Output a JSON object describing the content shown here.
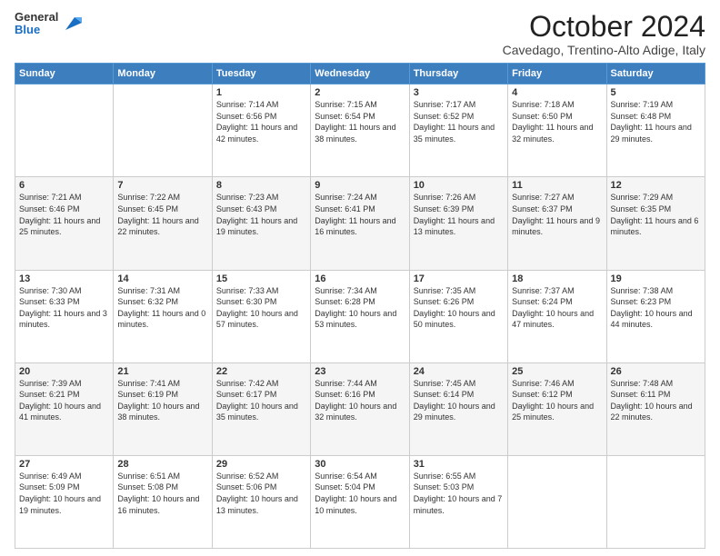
{
  "header": {
    "logo_general": "General",
    "logo_blue": "Blue",
    "month_title": "October 2024",
    "location": "Cavedago, Trentino-Alto Adige, Italy"
  },
  "days_of_week": [
    "Sunday",
    "Monday",
    "Tuesday",
    "Wednesday",
    "Thursday",
    "Friday",
    "Saturday"
  ],
  "weeks": [
    [
      {
        "day": "",
        "info": ""
      },
      {
        "day": "",
        "info": ""
      },
      {
        "day": "1",
        "info": "Sunrise: 7:14 AM\nSunset: 6:56 PM\nDaylight: 11 hours and 42 minutes."
      },
      {
        "day": "2",
        "info": "Sunrise: 7:15 AM\nSunset: 6:54 PM\nDaylight: 11 hours and 38 minutes."
      },
      {
        "day": "3",
        "info": "Sunrise: 7:17 AM\nSunset: 6:52 PM\nDaylight: 11 hours and 35 minutes."
      },
      {
        "day": "4",
        "info": "Sunrise: 7:18 AM\nSunset: 6:50 PM\nDaylight: 11 hours and 32 minutes."
      },
      {
        "day": "5",
        "info": "Sunrise: 7:19 AM\nSunset: 6:48 PM\nDaylight: 11 hours and 29 minutes."
      }
    ],
    [
      {
        "day": "6",
        "info": "Sunrise: 7:21 AM\nSunset: 6:46 PM\nDaylight: 11 hours and 25 minutes."
      },
      {
        "day": "7",
        "info": "Sunrise: 7:22 AM\nSunset: 6:45 PM\nDaylight: 11 hours and 22 minutes."
      },
      {
        "day": "8",
        "info": "Sunrise: 7:23 AM\nSunset: 6:43 PM\nDaylight: 11 hours and 19 minutes."
      },
      {
        "day": "9",
        "info": "Sunrise: 7:24 AM\nSunset: 6:41 PM\nDaylight: 11 hours and 16 minutes."
      },
      {
        "day": "10",
        "info": "Sunrise: 7:26 AM\nSunset: 6:39 PM\nDaylight: 11 hours and 13 minutes."
      },
      {
        "day": "11",
        "info": "Sunrise: 7:27 AM\nSunset: 6:37 PM\nDaylight: 11 hours and 9 minutes."
      },
      {
        "day": "12",
        "info": "Sunrise: 7:29 AM\nSunset: 6:35 PM\nDaylight: 11 hours and 6 minutes."
      }
    ],
    [
      {
        "day": "13",
        "info": "Sunrise: 7:30 AM\nSunset: 6:33 PM\nDaylight: 11 hours and 3 minutes."
      },
      {
        "day": "14",
        "info": "Sunrise: 7:31 AM\nSunset: 6:32 PM\nDaylight: 11 hours and 0 minutes."
      },
      {
        "day": "15",
        "info": "Sunrise: 7:33 AM\nSunset: 6:30 PM\nDaylight: 10 hours and 57 minutes."
      },
      {
        "day": "16",
        "info": "Sunrise: 7:34 AM\nSunset: 6:28 PM\nDaylight: 10 hours and 53 minutes."
      },
      {
        "day": "17",
        "info": "Sunrise: 7:35 AM\nSunset: 6:26 PM\nDaylight: 10 hours and 50 minutes."
      },
      {
        "day": "18",
        "info": "Sunrise: 7:37 AM\nSunset: 6:24 PM\nDaylight: 10 hours and 47 minutes."
      },
      {
        "day": "19",
        "info": "Sunrise: 7:38 AM\nSunset: 6:23 PM\nDaylight: 10 hours and 44 minutes."
      }
    ],
    [
      {
        "day": "20",
        "info": "Sunrise: 7:39 AM\nSunset: 6:21 PM\nDaylight: 10 hours and 41 minutes."
      },
      {
        "day": "21",
        "info": "Sunrise: 7:41 AM\nSunset: 6:19 PM\nDaylight: 10 hours and 38 minutes."
      },
      {
        "day": "22",
        "info": "Sunrise: 7:42 AM\nSunset: 6:17 PM\nDaylight: 10 hours and 35 minutes."
      },
      {
        "day": "23",
        "info": "Sunrise: 7:44 AM\nSunset: 6:16 PM\nDaylight: 10 hours and 32 minutes."
      },
      {
        "day": "24",
        "info": "Sunrise: 7:45 AM\nSunset: 6:14 PM\nDaylight: 10 hours and 29 minutes."
      },
      {
        "day": "25",
        "info": "Sunrise: 7:46 AM\nSunset: 6:12 PM\nDaylight: 10 hours and 25 minutes."
      },
      {
        "day": "26",
        "info": "Sunrise: 7:48 AM\nSunset: 6:11 PM\nDaylight: 10 hours and 22 minutes."
      }
    ],
    [
      {
        "day": "27",
        "info": "Sunrise: 6:49 AM\nSunset: 5:09 PM\nDaylight: 10 hours and 19 minutes."
      },
      {
        "day": "28",
        "info": "Sunrise: 6:51 AM\nSunset: 5:08 PM\nDaylight: 10 hours and 16 minutes."
      },
      {
        "day": "29",
        "info": "Sunrise: 6:52 AM\nSunset: 5:06 PM\nDaylight: 10 hours and 13 minutes."
      },
      {
        "day": "30",
        "info": "Sunrise: 6:54 AM\nSunset: 5:04 PM\nDaylight: 10 hours and 10 minutes."
      },
      {
        "day": "31",
        "info": "Sunrise: 6:55 AM\nSunset: 5:03 PM\nDaylight: 10 hours and 7 minutes."
      },
      {
        "day": "",
        "info": ""
      },
      {
        "day": "",
        "info": ""
      }
    ]
  ]
}
